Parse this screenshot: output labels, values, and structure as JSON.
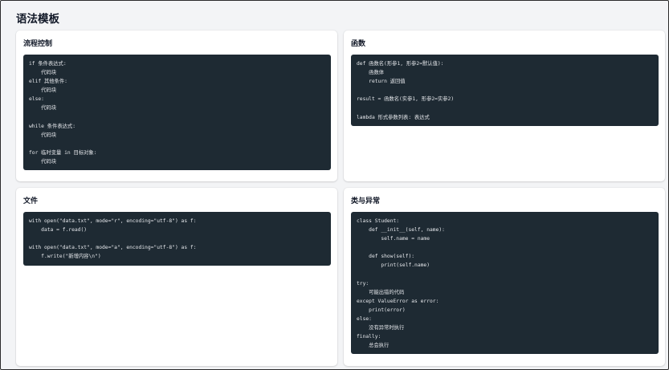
{
  "page": {
    "title": "语法模板"
  },
  "cards": {
    "flow": {
      "title": "流程控制",
      "lines": [
        "if 条件表达式:",
        "    代码块",
        "elif 其他条件:",
        "    代码块",
        "else:",
        "    代码块",
        "",
        "while 条件表达式:",
        "    代码块",
        "",
        "for 临时变量 in 目标对象:",
        "    代码块"
      ]
    },
    "function": {
      "title": "函数",
      "lines": [
        "def 函数名(形参1, 形参2=默认值):",
        "    函数体",
        "    return 返回值",
        "",
        "result = 函数名(实参1, 形参2=实参2)",
        "",
        "lambda 形式参数列表: 表达式"
      ]
    },
    "file": {
      "title": "文件",
      "lines": [
        "with open(\"data.txt\", mode=\"r\", encoding=\"utf-8\") as f:",
        "    data = f.read()",
        "",
        "with open(\"data.txt\", mode=\"a\", encoding=\"utf-8\") as f:",
        "    f.write(\"新增内容\\n\")"
      ]
    },
    "class_exception": {
      "title": "类与异常",
      "lines": [
        "class Student:",
        "    def __init__(self, name):",
        "        self.name = name",
        "",
        "    def show(self):",
        "        print(self.name)",
        "",
        "try:",
        "    可能出错的代码",
        "except ValueError as error:",
        "    print(error)",
        "else:",
        "    没有异常时执行",
        "finally:",
        "    总会执行"
      ]
    }
  }
}
